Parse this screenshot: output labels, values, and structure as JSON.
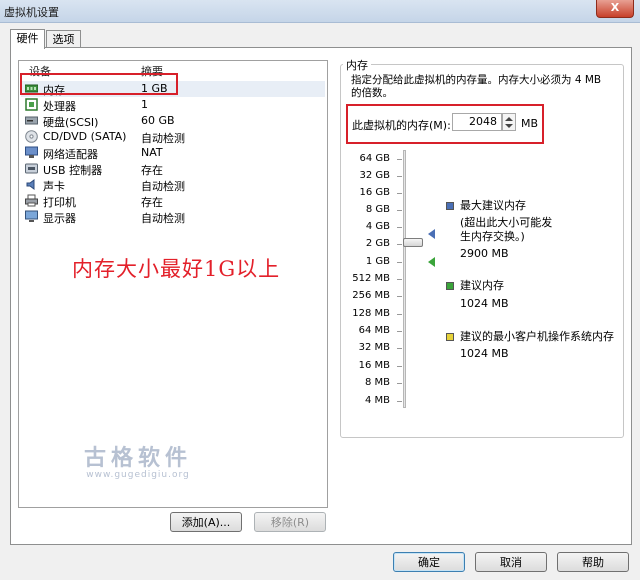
{
  "window": {
    "title": "虚拟机设置",
    "close_label": "X"
  },
  "tabs": [
    {
      "label": "硬件",
      "active": true
    },
    {
      "label": "选项",
      "active": false
    }
  ],
  "device_list": {
    "headers": {
      "device": "设备",
      "summary": "摘要"
    },
    "items": [
      {
        "name": "内存",
        "summary": "1 GB",
        "icon": "memory-icon",
        "selected": true
      },
      {
        "name": "处理器",
        "summary": "1",
        "icon": "processor-icon"
      },
      {
        "name": "硬盘(SCSI)",
        "summary": "60 GB",
        "icon": "hard-disk-icon"
      },
      {
        "name": "CD/DVD (SATA)",
        "summary": "自动检测",
        "icon": "cd-dvd-icon"
      },
      {
        "name": "网络适配器",
        "summary": "NAT",
        "icon": "network-adapter-icon"
      },
      {
        "name": "USB 控制器",
        "summary": "存在",
        "icon": "usb-icon"
      },
      {
        "name": "声卡",
        "summary": "自动检测",
        "icon": "sound-card-icon"
      },
      {
        "name": "打印机",
        "summary": "存在",
        "icon": "printer-icon"
      },
      {
        "name": "显示器",
        "summary": "自动检测",
        "icon": "display-icon"
      }
    ]
  },
  "annotation": "内存大小最好1G以上",
  "watermark": {
    "text": "古格软件",
    "url": "www.gugedigiu.org"
  },
  "buttons": {
    "add": "添加(A)...",
    "remove": "移除(R)",
    "ok": "确定",
    "cancel": "取消",
    "help": "帮助"
  },
  "memory": {
    "group_title": "内存",
    "description": "指定分配给此虚拟机的内存量。内存大小必须为 4 MB 的倍数。",
    "field_label": "此虚拟机的内存(M):",
    "value": "2048",
    "unit": "MB",
    "scale": [
      "64 GB",
      "32 GB",
      "16 GB",
      "8 GB",
      "4 GB",
      "2 GB",
      "1 GB",
      "512 MB",
      "256 MB",
      "128 MB",
      "64 MB",
      "32 MB",
      "16 MB",
      "8 MB",
      "4 MB"
    ],
    "legend": {
      "max": {
        "title": "最大建议内存",
        "note": "(超出此大小可能发生内存交换。)",
        "value": "2900 MB",
        "color": "#4a6fb5"
      },
      "recommended": {
        "title": "建议内存",
        "value": "1024 MB",
        "color": "#3aa43a"
      },
      "minimum": {
        "title": "建议的最小客户机操作系统内存",
        "value": "1024 MB",
        "color": "#e6d23a"
      }
    }
  }
}
